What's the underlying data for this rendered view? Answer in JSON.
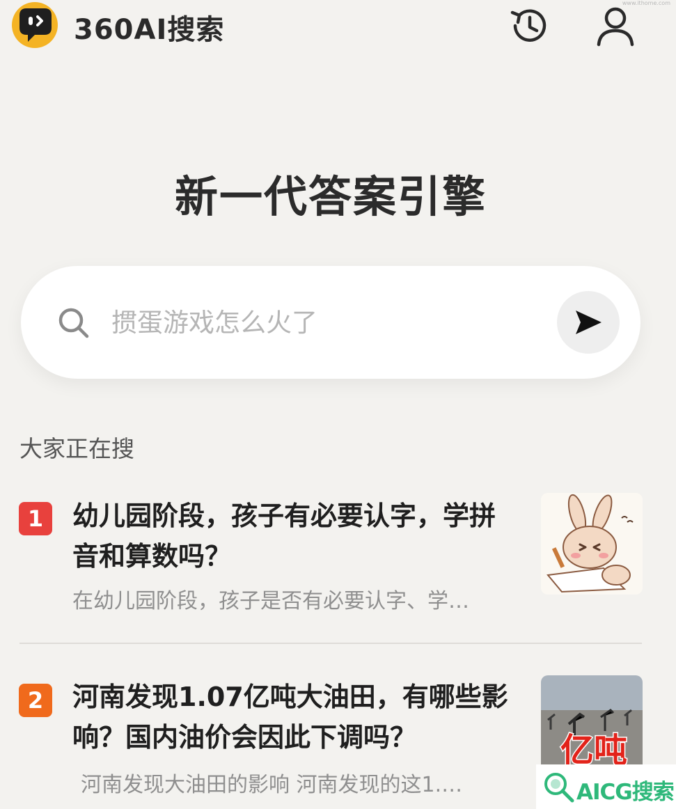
{
  "header": {
    "app_name": "360AI搜索",
    "watermark_small": "www.ithome.com"
  },
  "hero": {
    "title": "新一代答案引擎"
  },
  "search": {
    "placeholder": "掼蛋游戏怎么火了"
  },
  "trending": {
    "section_title": "大家正在搜",
    "items": [
      {
        "rank": "1",
        "title": "幼儿园阶段，孩子有必要认字，学拼音和算数吗？",
        "snippet": "在幼儿园阶段，孩子是否有必要认字、学…",
        "badge_color": "#e8413d"
      },
      {
        "rank": "2",
        "title": "河南发现1.07亿吨大油田，有哪些影响？国内油价会因此下调吗？",
        "snippet": "河南发现大油田的影响  河南发现的这1.…",
        "badge_color": "#f06a1c",
        "thumb_text": "亿吨"
      }
    ]
  },
  "watermark": {
    "text": "AICG搜索"
  },
  "colors": {
    "accent_yellow": "#f4b324",
    "background": "#f3f2ef",
    "watermark_green": "#2eb87a"
  }
}
